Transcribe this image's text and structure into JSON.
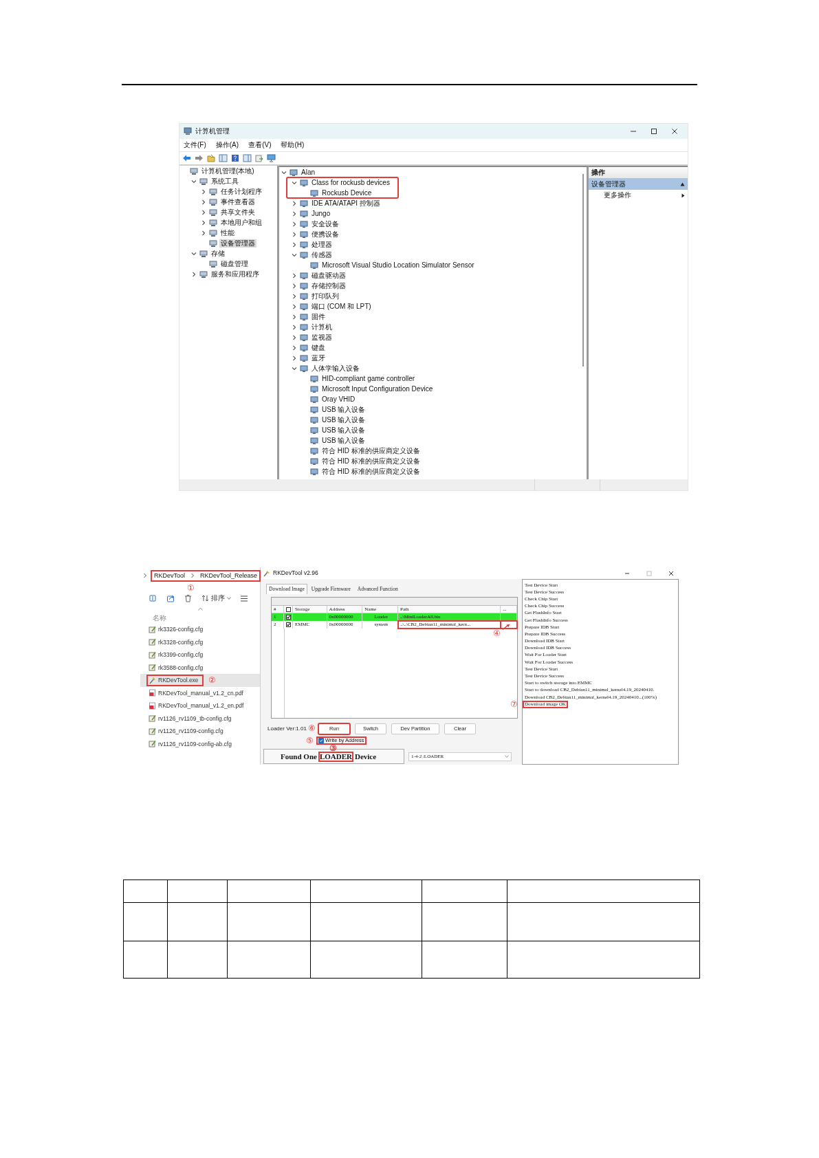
{
  "computer_management": {
    "window": {
      "title": "计算机管理"
    },
    "menu": [
      "文件(F)",
      "操作(A)",
      "查看(V)",
      "帮助(H)"
    ],
    "console_tree": [
      {
        "label": "计算机管理(本地)",
        "selected": false,
        "children": [
          {
            "label": "系统工具",
            "expanded": true,
            "selected": false,
            "children": [
              {
                "label": "任务计划程序",
                "expanded": false,
                "selected": false
              },
              {
                "label": "事件查看器",
                "expanded": false,
                "selected": false
              },
              {
                "label": "共享文件夹",
                "expanded": false,
                "selected": false
              },
              {
                "label": "本地用户和组",
                "expanded": false,
                "selected": false
              },
              {
                "label": "性能",
                "expanded": false,
                "selected": false
              },
              {
                "label": "设备管理器",
                "selected": true
              }
            ]
          },
          {
            "label": "存储",
            "expanded": true,
            "selected": false,
            "children": [
              {
                "label": "磁盘管理",
                "selected": false
              }
            ]
          },
          {
            "label": "服务和应用程序",
            "expanded": false,
            "selected": false
          }
        ]
      }
    ],
    "device_tree": [
      {
        "label": "Alan",
        "expanded": true,
        "children": [
          {
            "label": "Class for rockusb devices",
            "expanded": true,
            "annotated": true,
            "children": [
              {
                "label": "Rockusb Device"
              }
            ]
          },
          {
            "label": "IDE ATA/ATAPI 控制器",
            "expanded": false
          },
          {
            "label": "Jungo",
            "expanded": false
          },
          {
            "label": "安全设备",
            "expanded": false
          },
          {
            "label": "便携设备",
            "expanded": false
          },
          {
            "label": "处理器",
            "expanded": false
          },
          {
            "label": "传感器",
            "expanded": true,
            "children": [
              {
                "label": "Microsoft Visual Studio Location Simulator Sensor"
              }
            ]
          },
          {
            "label": "磁盘驱动器",
            "expanded": false
          },
          {
            "label": "存储控制器",
            "expanded": false
          },
          {
            "label": "打印队列",
            "expanded": false
          },
          {
            "label": "端口 (COM 和 LPT)",
            "expanded": false
          },
          {
            "label": "固件",
            "expanded": false
          },
          {
            "label": "计算机",
            "expanded": false
          },
          {
            "label": "监视器",
            "expanded": false
          },
          {
            "label": "键盘",
            "expanded": false
          },
          {
            "label": "蓝牙",
            "expanded": false
          },
          {
            "label": "人体学输入设备",
            "expanded": true,
            "children": [
              {
                "label": "HID-compliant game controller"
              },
              {
                "label": "Microsoft Input Configuration Device"
              },
              {
                "label": "Oray VHID"
              },
              {
                "label": "USB 输入设备"
              },
              {
                "label": "USB 输入设备"
              },
              {
                "label": "USB 输入设备"
              },
              {
                "label": "USB 输入设备"
              },
              {
                "label": "符合 HID 标准的供应商定义设备"
              },
              {
                "label": "符合 HID 标准的供应商定义设备"
              },
              {
                "label": "符合 HID 标准的供应商定义设备"
              }
            ]
          }
        ]
      }
    ],
    "actions": {
      "header": "操作",
      "section": {
        "label": "设备管理器",
        "expanded": true
      },
      "items": [
        {
          "label": "更多操作"
        }
      ]
    }
  },
  "file_explorer": {
    "breadcrumb": {
      "items": [
        "RKDevTool",
        "RKDevTool_Release"
      ],
      "annotated": true,
      "marker": "①"
    },
    "sort_label": "排序",
    "column_header": "名称",
    "files": [
      {
        "name": "rk3326-config.cfg",
        "kind": "cfg",
        "selected": false,
        "annotated": false
      },
      {
        "name": "rk3328-config.cfg",
        "kind": "cfg",
        "selected": false,
        "annotated": false
      },
      {
        "name": "rk3399-config.cfg",
        "kind": "cfg",
        "selected": false,
        "annotated": false
      },
      {
        "name": "rk3588-config.cfg",
        "kind": "cfg",
        "selected": false,
        "annotated": false
      },
      {
        "name": "RKDevTool.exe",
        "kind": "exe",
        "selected": true,
        "annotated": true,
        "marker": "②"
      },
      {
        "name": "RKDevTool_manual_v1.2_cn.pdf",
        "kind": "pdf",
        "selected": false,
        "annotated": false
      },
      {
        "name": "RKDevTool_manual_v1.2_en.pdf",
        "kind": "pdf",
        "selected": false,
        "annotated": false
      },
      {
        "name": "rv1126_rv1109_tb-config.cfg",
        "kind": "cfg",
        "selected": false,
        "annotated": false
      },
      {
        "name": "rv1126_rv1109-config.cfg",
        "kind": "cfg",
        "selected": false,
        "annotated": false
      },
      {
        "name": "rv1126_rv1109-config-ab.cfg",
        "kind": "cfg",
        "selected": false,
        "annotated": false
      }
    ]
  },
  "rkdevtool": {
    "window": {
      "title": "RKDevTool v2.96"
    },
    "tabs": [
      {
        "label": "Download Image",
        "selected": true
      },
      {
        "label": "Upgrade Firmware",
        "selected": false
      },
      {
        "label": "Advanced Function",
        "selected": false
      }
    ],
    "columns": [
      {
        "kind": "text",
        "label": "#"
      },
      {
        "kind": "checkbox",
        "checked": false
      },
      {
        "kind": "text",
        "label": "Storage"
      },
      {
        "kind": "text",
        "label": "Address"
      },
      {
        "kind": "text",
        "label": "Name"
      },
      {
        "kind": "text",
        "label": "Path"
      },
      {
        "kind": "text",
        "label": "..."
      }
    ],
    "rows": [
      {
        "number": "1",
        "checked": true,
        "address": "0x00000000",
        "name": "Loader",
        "path": "..\\MiniLoaderAll.bin",
        "selected": true,
        "path_annotated": false
      },
      {
        "number": "2",
        "checked": true,
        "storage": "EMMC",
        "address": "0x00000000",
        "name": "system",
        "path": "..\\..\\CB2_Debian11_minimal_kern...",
        "selected": false,
        "path_annotated": true,
        "marker": "④"
      }
    ],
    "loader_version": "Loader Ver:1.01",
    "buttons": [
      {
        "label": "Run",
        "annotated": true,
        "marker": "⑥"
      },
      {
        "label": "Switch",
        "annotated": false
      },
      {
        "label": "Dev Partition",
        "annotated": false
      },
      {
        "label": "Clear",
        "annotated": false
      }
    ],
    "write_by_address": {
      "label": "Write by Address",
      "checked": true,
      "annotated": true,
      "marker": "⑤"
    },
    "status": {
      "before": "Found One",
      "boxed": "LOADER",
      "after": "Device",
      "marker": "③"
    },
    "device_select": {
      "value": "1-4-2 :LOADER"
    },
    "log": [
      {
        "text": "Test Device Start",
        "annotated": false
      },
      {
        "text": "Test Device Success",
        "annotated": false
      },
      {
        "text": "Check Chip Start",
        "annotated": false
      },
      {
        "text": "Check Chip Success",
        "annotated": false
      },
      {
        "text": "Get FlashInfo Start",
        "annotated": false
      },
      {
        "text": "Get FlashInfo Success",
        "annotated": false
      },
      {
        "text": "Prepare IDB Start",
        "annotated": false
      },
      {
        "text": "Prepare IDB Success",
        "annotated": false
      },
      {
        "text": "Download IDB Start",
        "annotated": false
      },
      {
        "text": "Download IDB Success",
        "annotated": false
      },
      {
        "text": "Wait For Loader Start",
        "annotated": false
      },
      {
        "text": "Wait For Loader Success",
        "annotated": false
      },
      {
        "text": "Test Device Start",
        "annotated": false
      },
      {
        "text": "Test Device Success",
        "annotated": false
      },
      {
        "text": "Start to switch storage into EMMC",
        "annotated": false
      },
      {
        "text": "Start to download CB2_Debian11_minimal_kernel4.19_20240410.",
        "annotated": false
      },
      {
        "text": "Download CB2_Debian11_minimal_kernel4.19_20240410...(100%)",
        "annotated": false
      },
      {
        "text": "Download image OK",
        "annotated": true,
        "marker": "⑦"
      }
    ]
  }
}
